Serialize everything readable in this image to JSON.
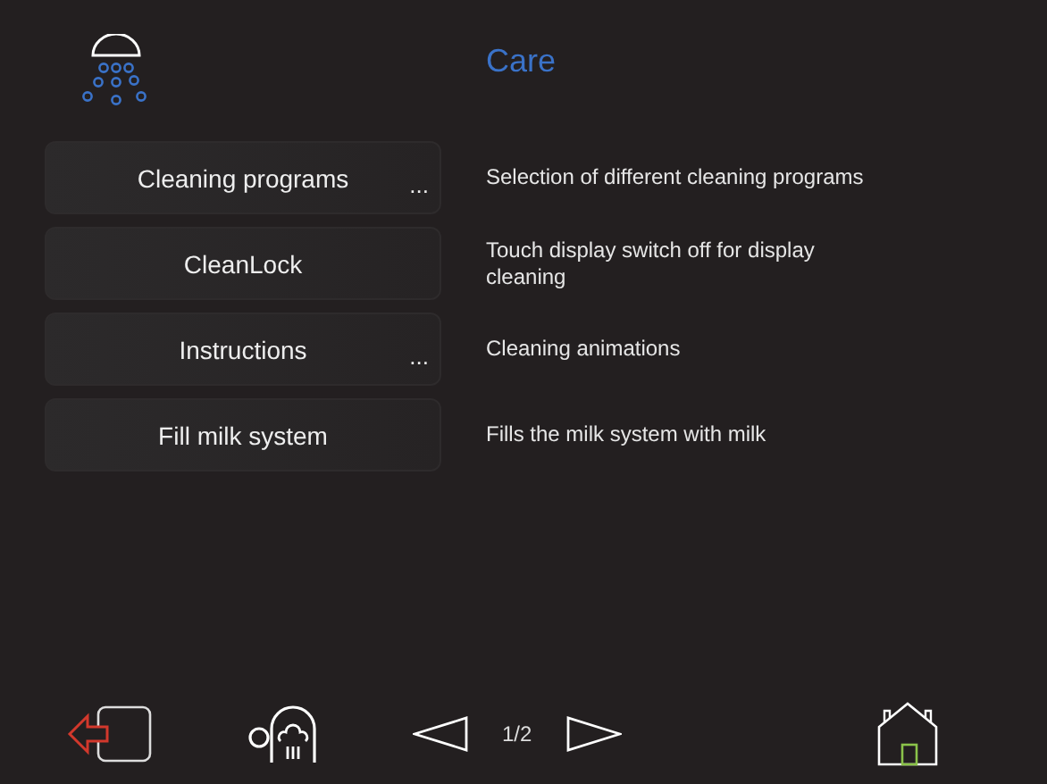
{
  "header": {
    "title": "Care"
  },
  "items": [
    {
      "label": "Cleaning programs",
      "more": "...",
      "description": "Selection of different cleaning programs"
    },
    {
      "label": "CleanLock",
      "description": "Touch display switch off for display cleaning"
    },
    {
      "label": "Instructions",
      "more": "...",
      "description": "Cleaning animations"
    },
    {
      "label": "Fill milk system",
      "description": "Fills the milk system with milk"
    }
  ],
  "footer": {
    "page": "1/2"
  }
}
